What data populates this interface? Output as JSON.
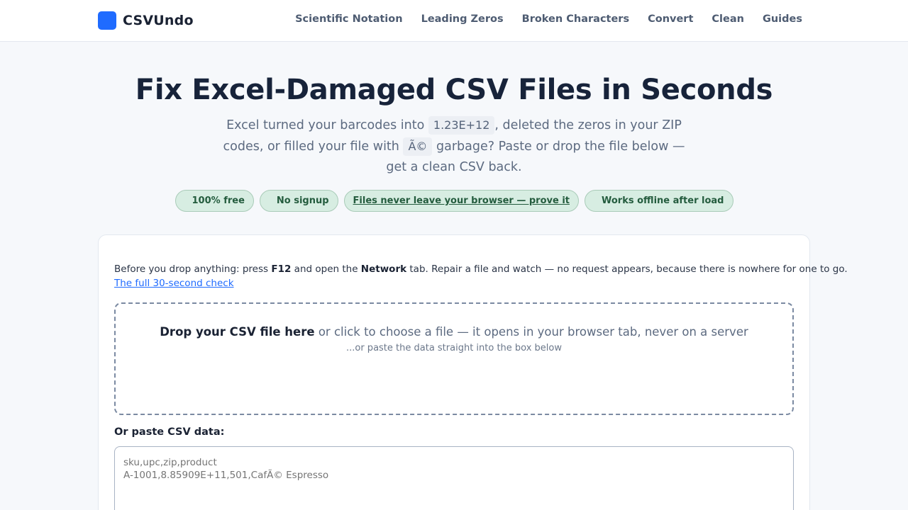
{
  "header": {
    "brand": "CSVUndo",
    "nav": [
      "Scientific Notation",
      "Leading Zeros",
      "Broken Characters",
      "Convert",
      "Clean",
      "Guides"
    ]
  },
  "hero": {
    "title": "Fix Excel-Damaged CSV Files in Seconds",
    "sub_part1": "Excel turned your barcodes into",
    "chip1": "1.23E+12",
    "sub_part2": ", deleted the zeros in your ZIP codes, or filled your file with",
    "chip2": "Ã©",
    "sub_part3": "garbage? Paste or drop the file below — get a clean CSV back."
  },
  "badges": {
    "free": "100% free",
    "signup": "No signup",
    "privacy": "Files never leave your browser — prove it",
    "offline": "Works offline after load"
  },
  "card": {
    "note_part1": "Before you drop anything: press",
    "note_key1": "F12",
    "note_part2": "and open the",
    "note_key2": "Network",
    "note_part3": "tab. Repair a file and watch — no request appears, because there is nowhere for one to go.",
    "check_link": "The full 30-second check",
    "drop_bold": "Drop your CSV file here",
    "drop_rest": "or click to choose a file — it opens in your browser tab, never on a server",
    "drop_sub": "...or paste the data straight into the box below",
    "paste_label": "Or paste CSV data:",
    "paste_placeholder": "sku,upc,zip,product\nA-1001,8.85909E+11,501,CafÃ© Espresso"
  }
}
